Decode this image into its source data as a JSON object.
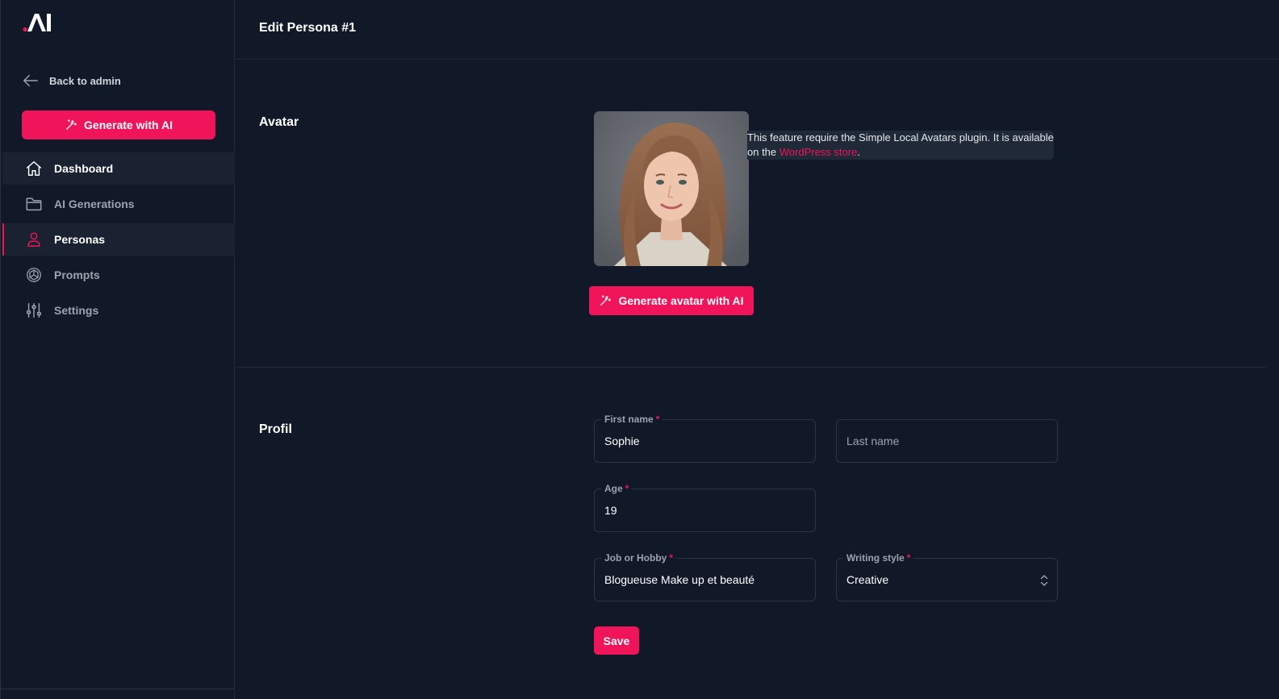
{
  "brand": {
    "accent": "#f0145a",
    "background": "#111827"
  },
  "sidebar": {
    "back_label": "Back to admin",
    "generate_label": "Generate with AI",
    "items": [
      {
        "label": "Dashboard",
        "icon": "home-icon",
        "state": "hover"
      },
      {
        "label": "AI Generations",
        "icon": "folder-icon",
        "state": "normal"
      },
      {
        "label": "Personas",
        "icon": "user-icon",
        "state": "active"
      },
      {
        "label": "Prompts",
        "icon": "openai-icon",
        "state": "normal"
      },
      {
        "label": "Settings",
        "icon": "sliders-icon",
        "state": "normal"
      }
    ]
  },
  "header": {
    "title": "Edit Persona #1"
  },
  "avatar_section": {
    "title": "Avatar",
    "notice_text": "This feature require the Simple Local Avatars plugin. It is available on the ",
    "notice_link": "WordPress store",
    "notice_end": ".",
    "generate_label": "Generate avatar with AI"
  },
  "profile_section": {
    "title": "Profil",
    "first_name": {
      "label": "First name",
      "required": "*",
      "value": "Sophie"
    },
    "last_name": {
      "placeholder": "Last name",
      "value": ""
    },
    "age": {
      "label": "Age",
      "required": "*",
      "value": "19"
    },
    "job": {
      "label": "Job or Hobby",
      "required": "*",
      "value": "Blogueuse Make up et beauté"
    },
    "writing_style": {
      "label": "Writing style",
      "required": "*",
      "value": "Creative"
    },
    "save_label": "Save"
  }
}
